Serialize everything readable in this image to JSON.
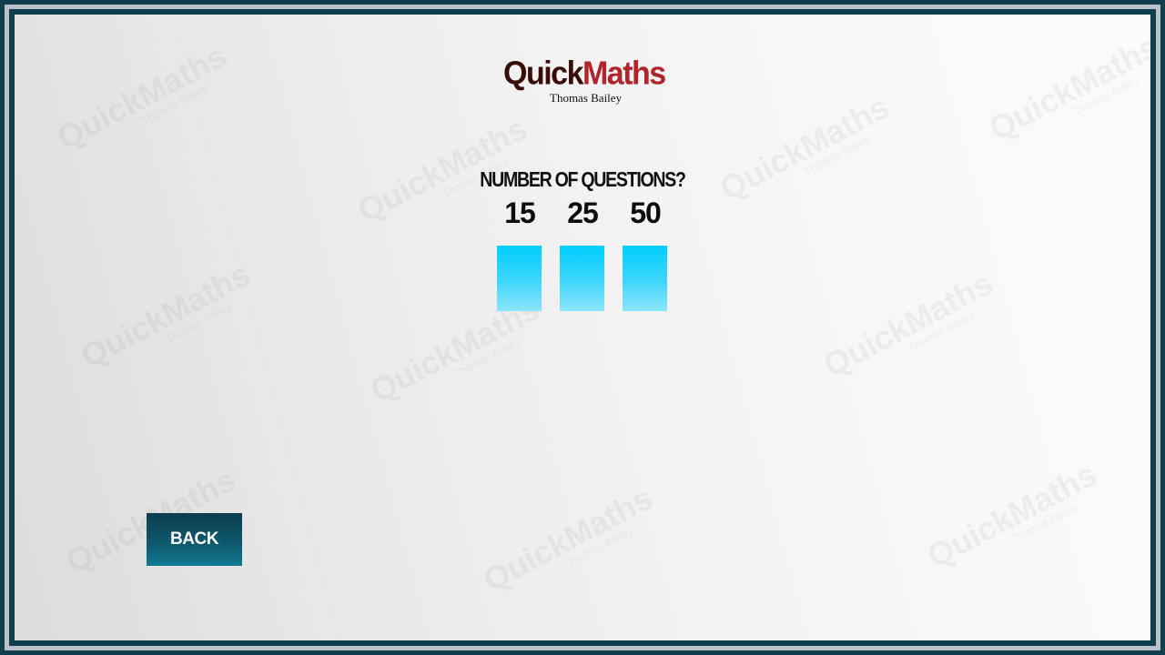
{
  "app": {
    "logo_quick": "Quick",
    "logo_maths": "Maths",
    "author": "Thomas Bailey"
  },
  "watermark": {
    "text": "QuickMaths",
    "subtext": "Thomas Bailey"
  },
  "question": {
    "title": "NUMBER OF QUESTIONS?",
    "options": [
      {
        "label": "15"
      },
      {
        "label": "25"
      },
      {
        "label": "50"
      }
    ]
  },
  "navigation": {
    "back_label": "BACK"
  },
  "colors": {
    "frame": "#133e4d",
    "tile": "#00cfff",
    "back_button": "#0e5a6f",
    "logo_dark": "#3a0c08",
    "logo_red": "#b0242a"
  }
}
